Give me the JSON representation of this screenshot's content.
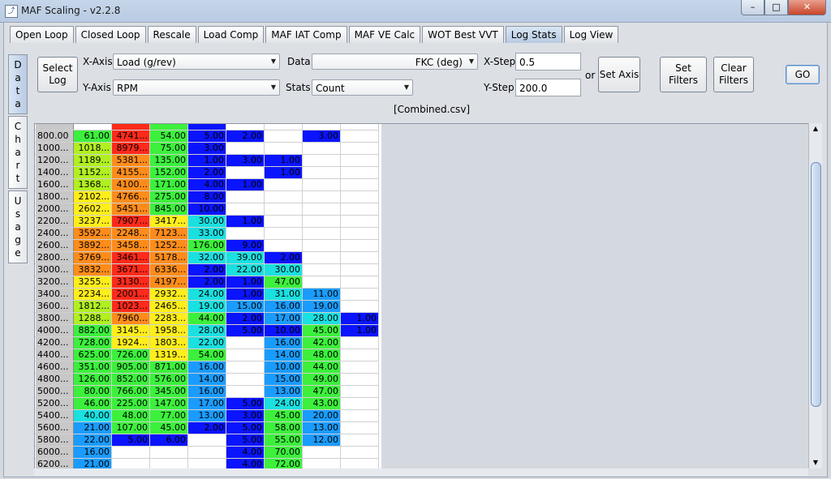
{
  "window": {
    "title": "MAF Scaling - v2.2.8",
    "min": "–",
    "max": "□",
    "close": "✕"
  },
  "tabs": [
    "Open Loop",
    "Closed Loop",
    "Rescale",
    "Load Comp",
    "MAF IAT Comp",
    "MAF VE Calc",
    "WOT Best VVT",
    "Log Stats",
    "Log View"
  ],
  "active_tab": "Log Stats",
  "side_tabs": [
    {
      "label": "Data",
      "chars": [
        "D",
        "a",
        "t",
        "a"
      ]
    },
    {
      "label": "Chart",
      "chars": [
        "C",
        "h",
        "a",
        "r",
        "t"
      ]
    },
    {
      "label": "Usage",
      "chars": [
        "U",
        "s",
        "a",
        "g",
        "e"
      ]
    }
  ],
  "controls": {
    "select_log": "Select Log",
    "x_axis_label": "X-Axis",
    "x_axis_value": "Load (g/rev)",
    "y_axis_label": "Y-Axis",
    "y_axis_value": "RPM",
    "data_label": "Data",
    "data_value": "FKC (deg)",
    "stats_label": "Stats",
    "stats_value": "Count",
    "x_step_label": "X-Step",
    "x_step_value": "0.5",
    "y_step_label": "Y-Step",
    "y_step_value": "200.0",
    "or_label": "or",
    "set_axis": "Set Axis",
    "set_filters": "Set Filters",
    "clear_filters": "Clear Filters",
    "go": "GO",
    "file_name": "[Combined.csv]"
  },
  "colors": {
    "red": "#ff2a1a",
    "orange": "#ff8c1a",
    "yellow": "#ffee1a",
    "green": "#3cf03c",
    "lime": "#b0f020",
    "cyan": "#1ae0e0",
    "sky": "#1a9cff",
    "blue": "#0a14ff"
  },
  "grid": {
    "rows": [
      {
        "rpm": "800.00",
        "cells": [
          [
            "61.00",
            "green"
          ],
          [
            "4741...",
            "red"
          ],
          [
            "54.00",
            "green"
          ],
          [
            "5.00",
            "blue"
          ],
          [
            "2.00",
            "blue"
          ],
          [
            "",
            ""
          ],
          [
            "3.00",
            "blue"
          ],
          [
            "",
            ""
          ]
        ]
      },
      {
        "rpm": "1000...",
        "cells": [
          [
            "1018...",
            "lime"
          ],
          [
            "8979...",
            "red"
          ],
          [
            "75.00",
            "green"
          ],
          [
            "3.00",
            "blue"
          ],
          [
            "",
            ""
          ],
          [
            "",
            ""
          ],
          [
            "",
            ""
          ],
          [
            "",
            ""
          ]
        ]
      },
      {
        "rpm": "1200...",
        "cells": [
          [
            "1189...",
            "lime"
          ],
          [
            "5381...",
            "orange"
          ],
          [
            "135.00",
            "green"
          ],
          [
            "1.00",
            "blue"
          ],
          [
            "3.00",
            "blue"
          ],
          [
            "1.00",
            "blue"
          ],
          [
            "",
            ""
          ],
          [
            "",
            ""
          ]
        ]
      },
      {
        "rpm": "1400...",
        "cells": [
          [
            "1152...",
            "lime"
          ],
          [
            "4155...",
            "orange"
          ],
          [
            "152.00",
            "green"
          ],
          [
            "2.00",
            "blue"
          ],
          [
            "",
            ""
          ],
          [
            "1.00",
            "blue"
          ],
          [
            "",
            ""
          ],
          [
            "",
            ""
          ]
        ]
      },
      {
        "rpm": "1600...",
        "cells": [
          [
            "1368...",
            "lime"
          ],
          [
            "4100...",
            "orange"
          ],
          [
            "171.00",
            "green"
          ],
          [
            "4.00",
            "blue"
          ],
          [
            "1.00",
            "blue"
          ],
          [
            "",
            ""
          ],
          [
            "",
            ""
          ],
          [
            "",
            ""
          ]
        ]
      },
      {
        "rpm": "1800...",
        "cells": [
          [
            "2102...",
            "yellow"
          ],
          [
            "4766...",
            "orange"
          ],
          [
            "275.00",
            "green"
          ],
          [
            "8.00",
            "blue"
          ],
          [
            "",
            ""
          ],
          [
            "",
            ""
          ],
          [
            "",
            ""
          ],
          [
            "",
            ""
          ]
        ]
      },
      {
        "rpm": "2000...",
        "cells": [
          [
            "2602...",
            "yellow"
          ],
          [
            "5451...",
            "orange"
          ],
          [
            "845.00",
            "green"
          ],
          [
            "10.00",
            "blue"
          ],
          [
            "",
            ""
          ],
          [
            "",
            ""
          ],
          [
            "",
            ""
          ],
          [
            "",
            ""
          ]
        ]
      },
      {
        "rpm": "2200...",
        "cells": [
          [
            "3237...",
            "yellow"
          ],
          [
            "7907...",
            "red"
          ],
          [
            "3417...",
            "yellow"
          ],
          [
            "30.00",
            "cyan"
          ],
          [
            "1.00",
            "blue"
          ],
          [
            "",
            ""
          ],
          [
            "",
            ""
          ],
          [
            "",
            ""
          ]
        ]
      },
      {
        "rpm": "2400...",
        "cells": [
          [
            "3592...",
            "orange"
          ],
          [
            "2248...",
            "orange"
          ],
          [
            "7123...",
            "orange"
          ],
          [
            "33.00",
            "cyan"
          ],
          [
            "",
            ""
          ],
          [
            "",
            ""
          ],
          [
            "",
            ""
          ],
          [
            "",
            ""
          ]
        ]
      },
      {
        "rpm": "2600...",
        "cells": [
          [
            "3892...",
            "orange"
          ],
          [
            "3458...",
            "orange"
          ],
          [
            "1252...",
            "orange"
          ],
          [
            "176.00",
            "green"
          ],
          [
            "9.00",
            "blue"
          ],
          [
            "",
            ""
          ],
          [
            "",
            ""
          ],
          [
            "",
            ""
          ]
        ]
      },
      {
        "rpm": "2800...",
        "cells": [
          [
            "3769...",
            "orange"
          ],
          [
            "3461...",
            "red"
          ],
          [
            "5178...",
            "orange"
          ],
          [
            "32.00",
            "cyan"
          ],
          [
            "39.00",
            "cyan"
          ],
          [
            "2.00",
            "blue"
          ],
          [
            "",
            ""
          ],
          [
            "",
            ""
          ]
        ]
      },
      {
        "rpm": "3000...",
        "cells": [
          [
            "3832...",
            "orange"
          ],
          [
            "3671...",
            "red"
          ],
          [
            "6336...",
            "orange"
          ],
          [
            "2.00",
            "blue"
          ],
          [
            "22.00",
            "cyan"
          ],
          [
            "30.00",
            "cyan"
          ],
          [
            "",
            ""
          ],
          [
            "",
            ""
          ]
        ]
      },
      {
        "rpm": "3200...",
        "cells": [
          [
            "3255...",
            "yellow"
          ],
          [
            "3130...",
            "red"
          ],
          [
            "4197...",
            "orange"
          ],
          [
            "2.00",
            "blue"
          ],
          [
            "1.00",
            "blue"
          ],
          [
            "47.00",
            "green"
          ],
          [
            "",
            ""
          ],
          [
            "",
            ""
          ]
        ]
      },
      {
        "rpm": "3400...",
        "cells": [
          [
            "2234...",
            "yellow"
          ],
          [
            "2001...",
            "red"
          ],
          [
            "2932...",
            "yellow"
          ],
          [
            "24.00",
            "cyan"
          ],
          [
            "1.00",
            "blue"
          ],
          [
            "31.00",
            "cyan"
          ],
          [
            "11.00",
            "sky"
          ],
          [
            "",
            ""
          ]
        ]
      },
      {
        "rpm": "3600...",
        "cells": [
          [
            "1812...",
            "lime"
          ],
          [
            "1023...",
            "red"
          ],
          [
            "2465...",
            "yellow"
          ],
          [
            "19.00",
            "cyan"
          ],
          [
            "15.00",
            "sky"
          ],
          [
            "16.00",
            "sky"
          ],
          [
            "19.00",
            "sky"
          ],
          [
            "",
            ""
          ]
        ]
      },
      {
        "rpm": "3800...",
        "cells": [
          [
            "1288...",
            "lime"
          ],
          [
            "7960...",
            "orange"
          ],
          [
            "2283...",
            "yellow"
          ],
          [
            "44.00",
            "green"
          ],
          [
            "2.00",
            "blue"
          ],
          [
            "17.00",
            "sky"
          ],
          [
            "28.00",
            "cyan"
          ],
          [
            "1.00",
            "blue"
          ]
        ]
      },
      {
        "rpm": "4000...",
        "cells": [
          [
            "882.00",
            "green"
          ],
          [
            "3145...",
            "yellow"
          ],
          [
            "1958...",
            "yellow"
          ],
          [
            "28.00",
            "cyan"
          ],
          [
            "5.00",
            "blue"
          ],
          [
            "10.00",
            "blue"
          ],
          [
            "45.00",
            "green"
          ],
          [
            "1.00",
            "blue"
          ]
        ]
      },
      {
        "rpm": "4200...",
        "cells": [
          [
            "728.00",
            "green"
          ],
          [
            "1924...",
            "yellow"
          ],
          [
            "1803...",
            "yellow"
          ],
          [
            "22.00",
            "cyan"
          ],
          [
            "",
            ""
          ],
          [
            "16.00",
            "sky"
          ],
          [
            "42.00",
            "green"
          ],
          [
            "",
            ""
          ]
        ]
      },
      {
        "rpm": "4400...",
        "cells": [
          [
            "625.00",
            "green"
          ],
          [
            "726.00",
            "green"
          ],
          [
            "1319...",
            "yellow"
          ],
          [
            "54.00",
            "green"
          ],
          [
            "",
            ""
          ],
          [
            "14.00",
            "sky"
          ],
          [
            "48.00",
            "green"
          ],
          [
            "",
            ""
          ]
        ]
      },
      {
        "rpm": "4600...",
        "cells": [
          [
            "351.00",
            "green"
          ],
          [
            "905.00",
            "green"
          ],
          [
            "871.00",
            "green"
          ],
          [
            "16.00",
            "sky"
          ],
          [
            "",
            ""
          ],
          [
            "10.00",
            "sky"
          ],
          [
            "44.00",
            "green"
          ],
          [
            "",
            ""
          ]
        ]
      },
      {
        "rpm": "4800...",
        "cells": [
          [
            "126.00",
            "green"
          ],
          [
            "852.00",
            "green"
          ],
          [
            "576.00",
            "green"
          ],
          [
            "14.00",
            "sky"
          ],
          [
            "",
            ""
          ],
          [
            "15.00",
            "sky"
          ],
          [
            "49.00",
            "green"
          ],
          [
            "",
            ""
          ]
        ]
      },
      {
        "rpm": "5000...",
        "cells": [
          [
            "80.00",
            "green"
          ],
          [
            "766.00",
            "green"
          ],
          [
            "345.00",
            "green"
          ],
          [
            "16.00",
            "sky"
          ],
          [
            "",
            ""
          ],
          [
            "13.00",
            "sky"
          ],
          [
            "47.00",
            "green"
          ],
          [
            "",
            ""
          ]
        ]
      },
      {
        "rpm": "5200...",
        "cells": [
          [
            "46.00",
            "green"
          ],
          [
            "225.00",
            "green"
          ],
          [
            "147.00",
            "green"
          ],
          [
            "17.00",
            "sky"
          ],
          [
            "5.00",
            "blue"
          ],
          [
            "24.00",
            "cyan"
          ],
          [
            "43.00",
            "green"
          ],
          [
            "",
            ""
          ]
        ]
      },
      {
        "rpm": "5400...",
        "cells": [
          [
            "40.00",
            "cyan"
          ],
          [
            "48.00",
            "green"
          ],
          [
            "77.00",
            "green"
          ],
          [
            "13.00",
            "sky"
          ],
          [
            "3.00",
            "blue"
          ],
          [
            "45.00",
            "green"
          ],
          [
            "20.00",
            "sky"
          ],
          [
            "",
            ""
          ]
        ]
      },
      {
        "rpm": "5600...",
        "cells": [
          [
            "21.00",
            "sky"
          ],
          [
            "107.00",
            "green"
          ],
          [
            "45.00",
            "green"
          ],
          [
            "2.00",
            "blue"
          ],
          [
            "5.00",
            "blue"
          ],
          [
            "58.00",
            "green"
          ],
          [
            "13.00",
            "sky"
          ],
          [
            "",
            ""
          ]
        ]
      },
      {
        "rpm": "5800...",
        "cells": [
          [
            "22.00",
            "sky"
          ],
          [
            "5.00",
            "blue"
          ],
          [
            "6.00",
            "blue"
          ],
          [
            "",
            ""
          ],
          [
            "5.00",
            "blue"
          ],
          [
            "55.00",
            "green"
          ],
          [
            "12.00",
            "sky"
          ],
          [
            "",
            ""
          ]
        ]
      },
      {
        "rpm": "6000...",
        "cells": [
          [
            "16.00",
            "sky"
          ],
          [
            "",
            ""
          ],
          [
            "",
            ""
          ],
          [
            "",
            ""
          ],
          [
            "4.00",
            "blue"
          ],
          [
            "70.00",
            "green"
          ],
          [
            "",
            ""
          ],
          [
            "",
            ""
          ]
        ]
      },
      {
        "rpm": "6200...",
        "cells": [
          [
            "21.00",
            "sky"
          ],
          [
            "",
            ""
          ],
          [
            "",
            ""
          ],
          [
            "",
            ""
          ],
          [
            "4.00",
            "blue"
          ],
          [
            "72.00",
            "green"
          ],
          [
            "",
            ""
          ],
          [
            "",
            ""
          ]
        ]
      }
    ]
  }
}
